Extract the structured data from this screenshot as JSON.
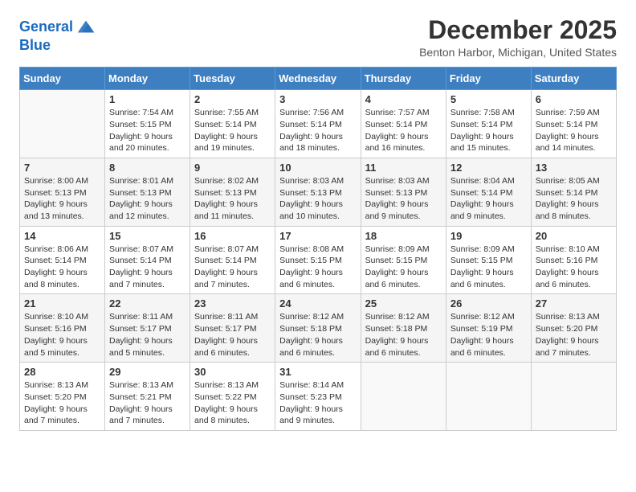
{
  "header": {
    "logo_line1": "General",
    "logo_line2": "Blue",
    "month": "December 2025",
    "location": "Benton Harbor, Michigan, United States"
  },
  "weekdays": [
    "Sunday",
    "Monday",
    "Tuesday",
    "Wednesday",
    "Thursday",
    "Friday",
    "Saturday"
  ],
  "weeks": [
    [
      {
        "day": "",
        "sunrise": "",
        "sunset": "",
        "daylight": ""
      },
      {
        "day": "1",
        "sunrise": "Sunrise: 7:54 AM",
        "sunset": "Sunset: 5:15 PM",
        "daylight": "Daylight: 9 hours and 20 minutes."
      },
      {
        "day": "2",
        "sunrise": "Sunrise: 7:55 AM",
        "sunset": "Sunset: 5:14 PM",
        "daylight": "Daylight: 9 hours and 19 minutes."
      },
      {
        "day": "3",
        "sunrise": "Sunrise: 7:56 AM",
        "sunset": "Sunset: 5:14 PM",
        "daylight": "Daylight: 9 hours and 18 minutes."
      },
      {
        "day": "4",
        "sunrise": "Sunrise: 7:57 AM",
        "sunset": "Sunset: 5:14 PM",
        "daylight": "Daylight: 9 hours and 16 minutes."
      },
      {
        "day": "5",
        "sunrise": "Sunrise: 7:58 AM",
        "sunset": "Sunset: 5:14 PM",
        "daylight": "Daylight: 9 hours and 15 minutes."
      },
      {
        "day": "6",
        "sunrise": "Sunrise: 7:59 AM",
        "sunset": "Sunset: 5:14 PM",
        "daylight": "Daylight: 9 hours and 14 minutes."
      }
    ],
    [
      {
        "day": "7",
        "sunrise": "Sunrise: 8:00 AM",
        "sunset": "Sunset: 5:13 PM",
        "daylight": "Daylight: 9 hours and 13 minutes."
      },
      {
        "day": "8",
        "sunrise": "Sunrise: 8:01 AM",
        "sunset": "Sunset: 5:13 PM",
        "daylight": "Daylight: 9 hours and 12 minutes."
      },
      {
        "day": "9",
        "sunrise": "Sunrise: 8:02 AM",
        "sunset": "Sunset: 5:13 PM",
        "daylight": "Daylight: 9 hours and 11 minutes."
      },
      {
        "day": "10",
        "sunrise": "Sunrise: 8:03 AM",
        "sunset": "Sunset: 5:13 PM",
        "daylight": "Daylight: 9 hours and 10 minutes."
      },
      {
        "day": "11",
        "sunrise": "Sunrise: 8:03 AM",
        "sunset": "Sunset: 5:13 PM",
        "daylight": "Daylight: 9 hours and 9 minutes."
      },
      {
        "day": "12",
        "sunrise": "Sunrise: 8:04 AM",
        "sunset": "Sunset: 5:14 PM",
        "daylight": "Daylight: 9 hours and 9 minutes."
      },
      {
        "day": "13",
        "sunrise": "Sunrise: 8:05 AM",
        "sunset": "Sunset: 5:14 PM",
        "daylight": "Daylight: 9 hours and 8 minutes."
      }
    ],
    [
      {
        "day": "14",
        "sunrise": "Sunrise: 8:06 AM",
        "sunset": "Sunset: 5:14 PM",
        "daylight": "Daylight: 9 hours and 8 minutes."
      },
      {
        "day": "15",
        "sunrise": "Sunrise: 8:07 AM",
        "sunset": "Sunset: 5:14 PM",
        "daylight": "Daylight: 9 hours and 7 minutes."
      },
      {
        "day": "16",
        "sunrise": "Sunrise: 8:07 AM",
        "sunset": "Sunset: 5:14 PM",
        "daylight": "Daylight: 9 hours and 7 minutes."
      },
      {
        "day": "17",
        "sunrise": "Sunrise: 8:08 AM",
        "sunset": "Sunset: 5:15 PM",
        "daylight": "Daylight: 9 hours and 6 minutes."
      },
      {
        "day": "18",
        "sunrise": "Sunrise: 8:09 AM",
        "sunset": "Sunset: 5:15 PM",
        "daylight": "Daylight: 9 hours and 6 minutes."
      },
      {
        "day": "19",
        "sunrise": "Sunrise: 8:09 AM",
        "sunset": "Sunset: 5:15 PM",
        "daylight": "Daylight: 9 hours and 6 minutes."
      },
      {
        "day": "20",
        "sunrise": "Sunrise: 8:10 AM",
        "sunset": "Sunset: 5:16 PM",
        "daylight": "Daylight: 9 hours and 6 minutes."
      }
    ],
    [
      {
        "day": "21",
        "sunrise": "Sunrise: 8:10 AM",
        "sunset": "Sunset: 5:16 PM",
        "daylight": "Daylight: 9 hours and 5 minutes."
      },
      {
        "day": "22",
        "sunrise": "Sunrise: 8:11 AM",
        "sunset": "Sunset: 5:17 PM",
        "daylight": "Daylight: 9 hours and 5 minutes."
      },
      {
        "day": "23",
        "sunrise": "Sunrise: 8:11 AM",
        "sunset": "Sunset: 5:17 PM",
        "daylight": "Daylight: 9 hours and 6 minutes."
      },
      {
        "day": "24",
        "sunrise": "Sunrise: 8:12 AM",
        "sunset": "Sunset: 5:18 PM",
        "daylight": "Daylight: 9 hours and 6 minutes."
      },
      {
        "day": "25",
        "sunrise": "Sunrise: 8:12 AM",
        "sunset": "Sunset: 5:18 PM",
        "daylight": "Daylight: 9 hours and 6 minutes."
      },
      {
        "day": "26",
        "sunrise": "Sunrise: 8:12 AM",
        "sunset": "Sunset: 5:19 PM",
        "daylight": "Daylight: 9 hours and 6 minutes."
      },
      {
        "day": "27",
        "sunrise": "Sunrise: 8:13 AM",
        "sunset": "Sunset: 5:20 PM",
        "daylight": "Daylight: 9 hours and 7 minutes."
      }
    ],
    [
      {
        "day": "28",
        "sunrise": "Sunrise: 8:13 AM",
        "sunset": "Sunset: 5:20 PM",
        "daylight": "Daylight: 9 hours and 7 minutes."
      },
      {
        "day": "29",
        "sunrise": "Sunrise: 8:13 AM",
        "sunset": "Sunset: 5:21 PM",
        "daylight": "Daylight: 9 hours and 7 minutes."
      },
      {
        "day": "30",
        "sunrise": "Sunrise: 8:13 AM",
        "sunset": "Sunset: 5:22 PM",
        "daylight": "Daylight: 9 hours and 8 minutes."
      },
      {
        "day": "31",
        "sunrise": "Sunrise: 8:14 AM",
        "sunset": "Sunset: 5:23 PM",
        "daylight": "Daylight: 9 hours and 9 minutes."
      },
      {
        "day": "",
        "sunrise": "",
        "sunset": "",
        "daylight": ""
      },
      {
        "day": "",
        "sunrise": "",
        "sunset": "",
        "daylight": ""
      },
      {
        "day": "",
        "sunrise": "",
        "sunset": "",
        "daylight": ""
      }
    ]
  ]
}
